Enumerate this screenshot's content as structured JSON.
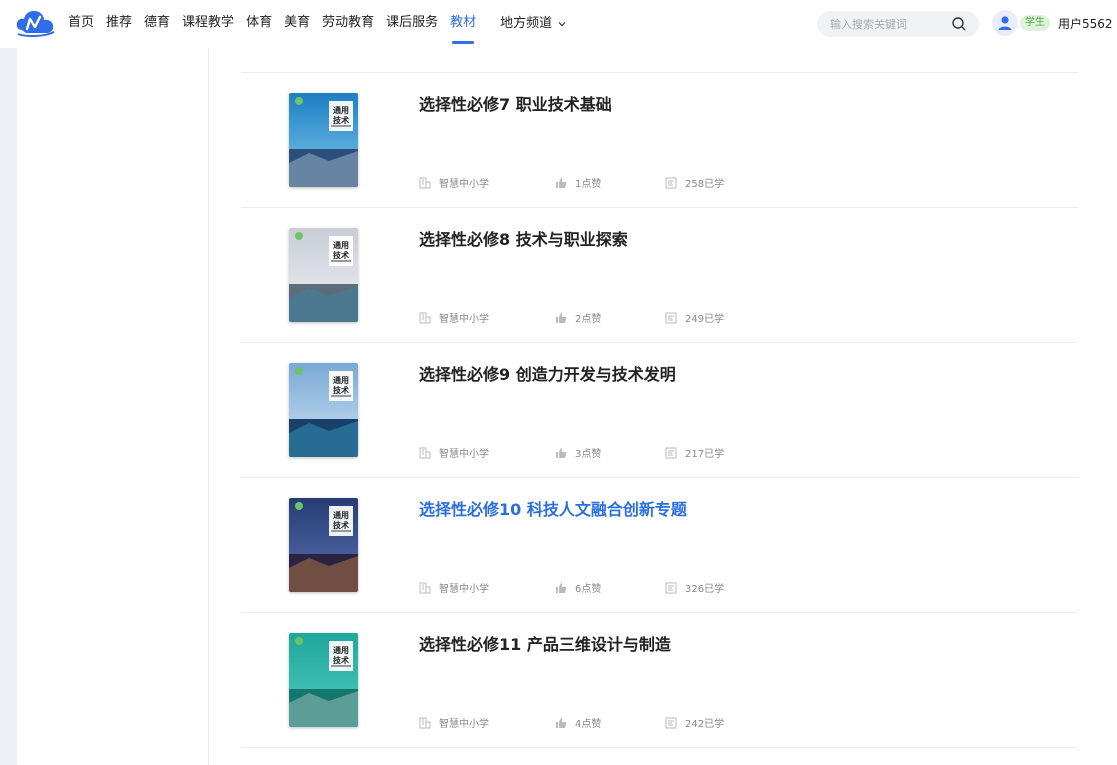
{
  "nav": {
    "items": [
      "首页",
      "推荐",
      "德育",
      "课程教学",
      "体育",
      "美育",
      "劳动教育",
      "课后服务",
      "教材"
    ],
    "active_index": 8,
    "dropdown_label": "地方频道"
  },
  "search": {
    "placeholder": "输入搜索关键词"
  },
  "user": {
    "role": "学生",
    "name": "用户5562"
  },
  "books": [
    {
      "title": "选择性必修7 职业技术基础",
      "cover_title_top": "通用",
      "cover_title_bottom": "技术",
      "source": "智慧中小学",
      "likes": "1点赞",
      "learned": "258已学",
      "highlight": false
    },
    {
      "title": "选择性必修8 技术与职业探索",
      "cover_title_top": "通用",
      "cover_title_bottom": "技术",
      "source": "智慧中小学",
      "likes": "2点赞",
      "learned": "249已学",
      "highlight": false
    },
    {
      "title": "选择性必修9 创造力开发与技术发明",
      "cover_title_top": "通用",
      "cover_title_bottom": "技术",
      "source": "智慧中小学",
      "likes": "3点赞",
      "learned": "217已学",
      "highlight": false
    },
    {
      "title": "选择性必修10 科技人文融合创新专题",
      "cover_title_top": "通用",
      "cover_title_bottom": "技术",
      "source": "智慧中小学",
      "likes": "6点赞",
      "learned": "326已学",
      "highlight": true
    },
    {
      "title": "选择性必修11 产品三维设计与制造",
      "cover_title_top": "通用",
      "cover_title_bottom": "技术",
      "source": "智慧中小学",
      "likes": "4点赞",
      "learned": "242已学",
      "highlight": false
    }
  ],
  "colors": {
    "accent": "#2f6ee8",
    "highlight_title": "#2a6fe0",
    "badge_bg": "#dff3dc",
    "badge_text": "#4cae3f"
  }
}
